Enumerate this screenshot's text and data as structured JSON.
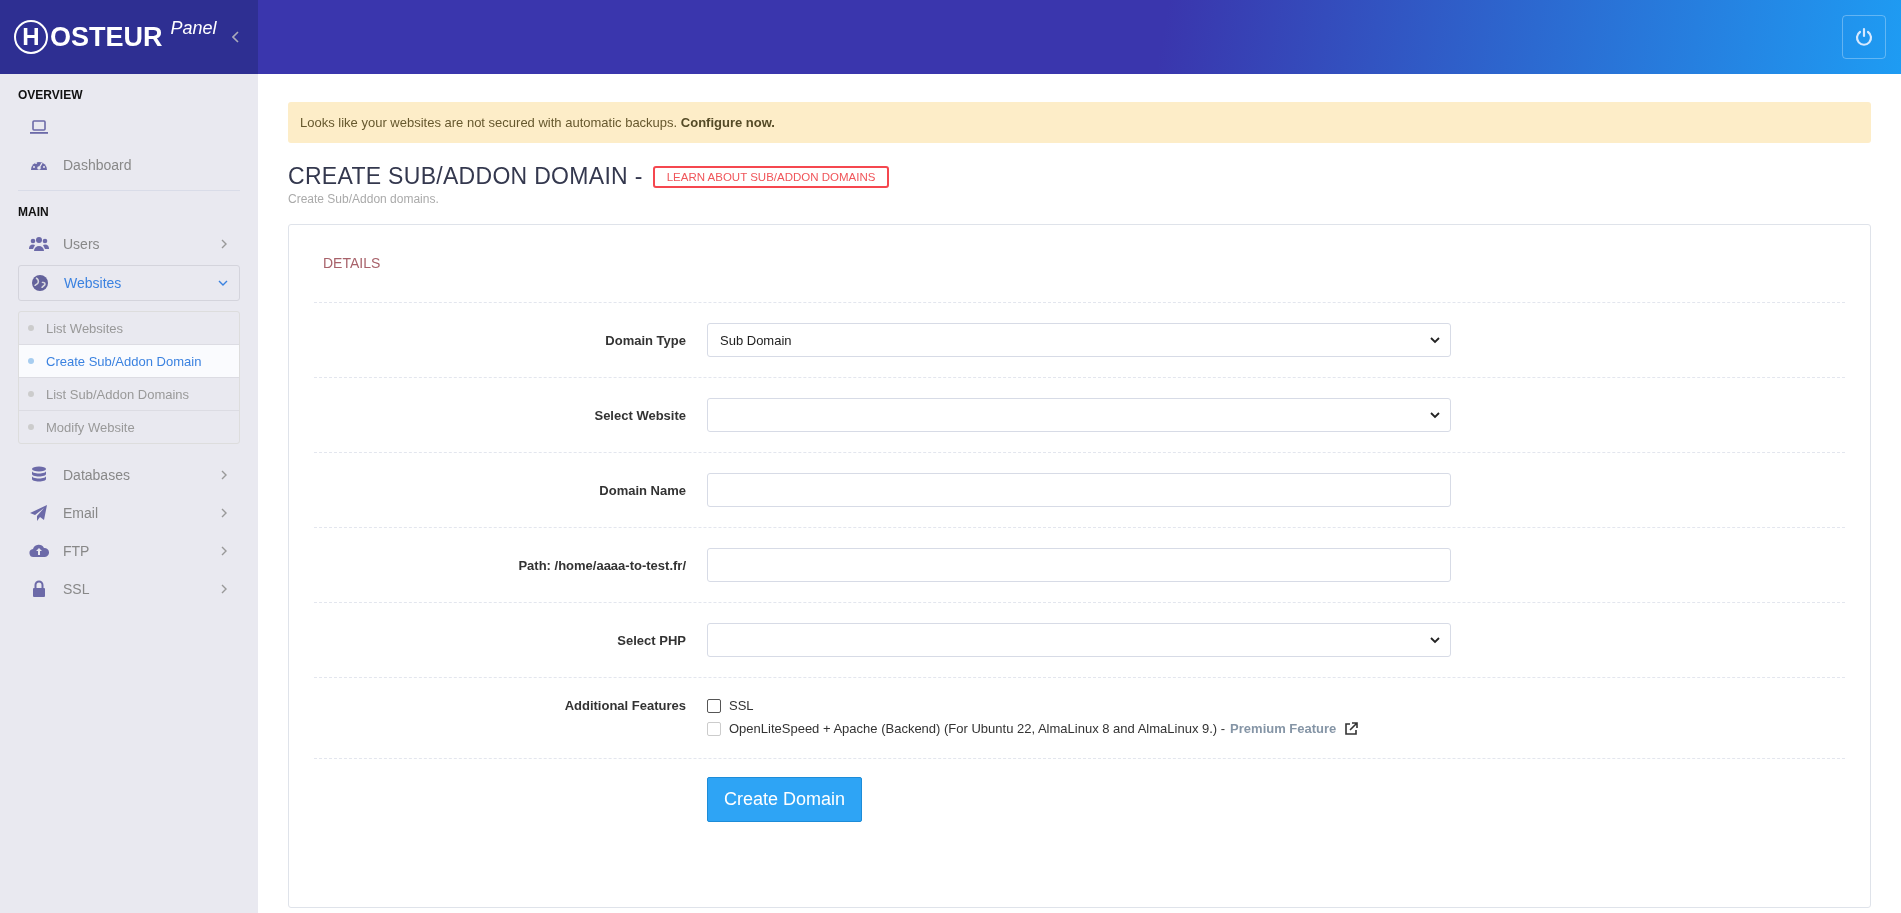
{
  "logo": {
    "mark": "H",
    "text": "OSTEUR",
    "sub": "Panel"
  },
  "sidebar": {
    "sections": [
      {
        "title": "OVERVIEW",
        "items": [
          {
            "selected": false
          },
          {
            "label": "Dashboard",
            "selected": false
          }
        ]
      },
      {
        "title": "MAIN",
        "items": [
          {
            "label": "Users",
            "selected": false,
            "expanded": false
          },
          {
            "label": "Websites",
            "selected": true,
            "expanded": true,
            "children": [
              {
                "label": "List Websites",
                "selected": false
              },
              {
                "label": "Create Sub/Addon Domain",
                "selected": true
              },
              {
                "label": "List Sub/Addon Domains",
                "selected": false
              },
              {
                "label": "Modify Website",
                "selected": false
              }
            ]
          },
          {
            "label": "Databases",
            "selected": false,
            "expanded": false
          },
          {
            "label": "Email",
            "selected": false,
            "expanded": false
          },
          {
            "label": "FTP",
            "selected": false,
            "expanded": false
          },
          {
            "label": "SSL",
            "selected": false,
            "expanded": false
          }
        ]
      }
    ]
  },
  "alert": {
    "text": "Looks like your websites are not secured with automatic backups.",
    "link": "Configure now."
  },
  "page": {
    "title": "CREATE SUB/ADDON DOMAIN -",
    "learn_button": "LEARN ABOUT SUB/ADDON DOMAINS",
    "subtitle": "Create Sub/Addon domains."
  },
  "card": {
    "heading": "DETAILS",
    "rows": [
      {
        "kind": "select",
        "label": "Domain Type",
        "value": "Sub Domain"
      },
      {
        "kind": "select",
        "label": "Select Website",
        "value": ""
      },
      {
        "kind": "input",
        "label": "Domain Name",
        "value": ""
      },
      {
        "kind": "input",
        "label": "Path: /home/aaaa-to-test.fr/",
        "value": ""
      },
      {
        "kind": "select",
        "label": "Select PHP",
        "value": ""
      },
      {
        "kind": "checks",
        "label": "Additional Features",
        "options": [
          {
            "label": "SSL",
            "checked": false,
            "disabled": false
          },
          {
            "label": "OpenLiteSpeed + Apache (Backend) (For Ubuntu 22, AlmaLinux 8 and AlmaLinux 9.) -",
            "checked": false,
            "disabled": true,
            "link": "Premium Feature"
          }
        ]
      }
    ],
    "submit": "Create Domain"
  }
}
